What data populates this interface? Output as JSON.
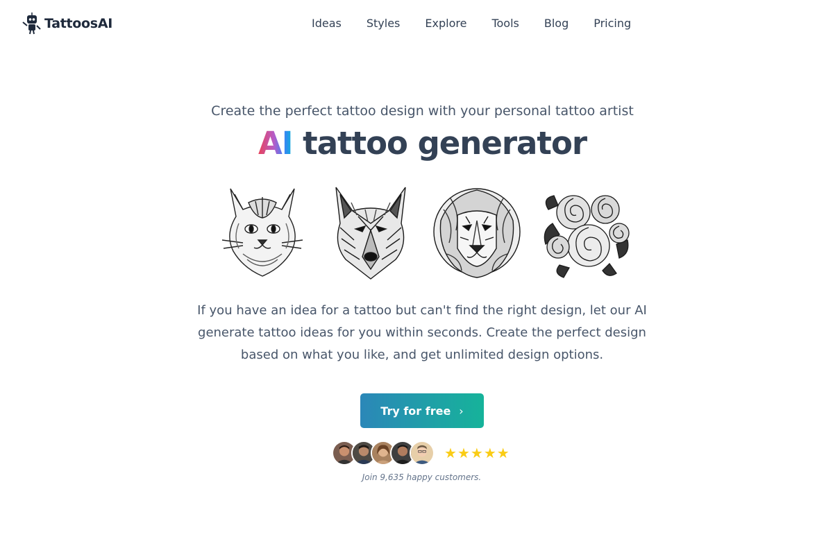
{
  "header": {
    "brand": "TattoosAI",
    "nav": [
      {
        "label": "Ideas"
      },
      {
        "label": "Styles"
      },
      {
        "label": "Explore"
      },
      {
        "label": "Tools"
      },
      {
        "label": "Blog"
      },
      {
        "label": "Pricing"
      }
    ]
  },
  "hero": {
    "subtitle": "Create the perfect tattoo design with your personal tattoo artist",
    "title_highlight": "AI",
    "title_rest": " tattoo generator",
    "description": "If you have an idea for a tattoo but can't find the right design, let our AI generate tattoo ideas for you within seconds. Create the perfect design based on what you like, and get unlimited design options.",
    "cta_label": "Try for free",
    "cta_icon": "chevron-right-icon",
    "customers_text": "Join 9,635 happy customers.",
    "rating_stars": 5,
    "gallery": [
      {
        "name": "cat-tattoo-image"
      },
      {
        "name": "wolf-tattoo-image"
      },
      {
        "name": "lion-tattoo-image"
      },
      {
        "name": "roses-tattoo-image"
      }
    ]
  },
  "colors": {
    "gradient_start": "#2b87b8",
    "gradient_end": "#16b39a",
    "star": "#facc15",
    "text": "#334155"
  }
}
